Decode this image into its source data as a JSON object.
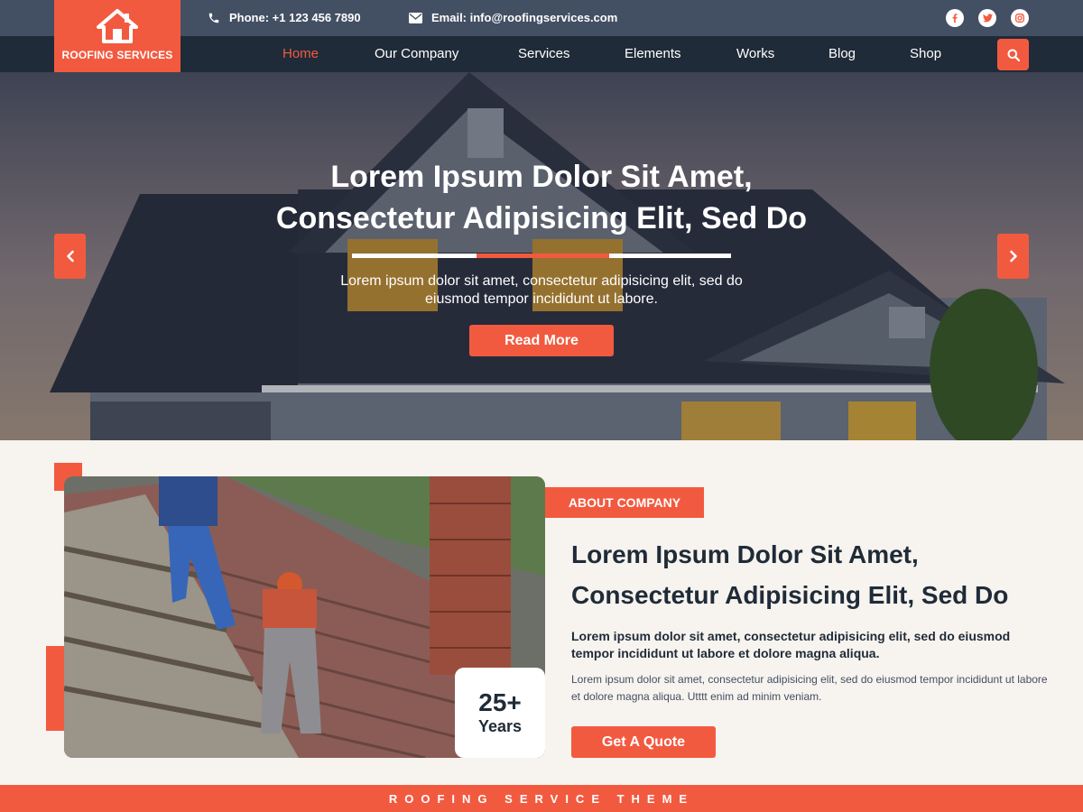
{
  "brand": {
    "name": "ROOFING SERVICES",
    "accent": "#f25a40",
    "dark": "#1f2b38"
  },
  "topbar": {
    "phone": "Phone: +1 123 456 7890",
    "email": "Email: info@roofingservices.com",
    "social": [
      "facebook-icon",
      "twitter-icon",
      "instagram-icon"
    ]
  },
  "nav": {
    "items": [
      "Home",
      "Our Company",
      "Services",
      "Elements",
      "Works",
      "Blog",
      "Shop"
    ],
    "active": "Home"
  },
  "hero": {
    "title_line1": "Lorem Ipsum Dolor Sit Amet,",
    "title_line2": "Consectetur Adipisicing Elit, Sed Do",
    "text_line1": "Lorem ipsum dolor sit amet, consectetur adipisicing elit, sed do",
    "text_line2": "eiusmod tempor  incididunt ut labore.",
    "button": "Read More"
  },
  "about": {
    "badge": "ABOUT COMPANY",
    "title_line1": "Lorem Ipsum Dolor Sit Amet,",
    "title_line2": "Consectetur Adipisicing Elit, Sed Do",
    "bold_text": "Lorem ipsum dolor sit amet, consectetur adipisicing elit, sed do eiusmod tempor incididunt ut labore et dolore magna aliqua.",
    "text": "Lorem ipsum dolor sit amet, consectetur adipisicing elit, sed do eiusmod tempor  incididunt ut labore et dolore magna aliqua. Utttt enim ad minim veniam.",
    "years_number": "25+",
    "years_label": "Years",
    "button": "Get A Quote"
  },
  "footer": {
    "label": "ROOFING SERVICE THEME"
  }
}
